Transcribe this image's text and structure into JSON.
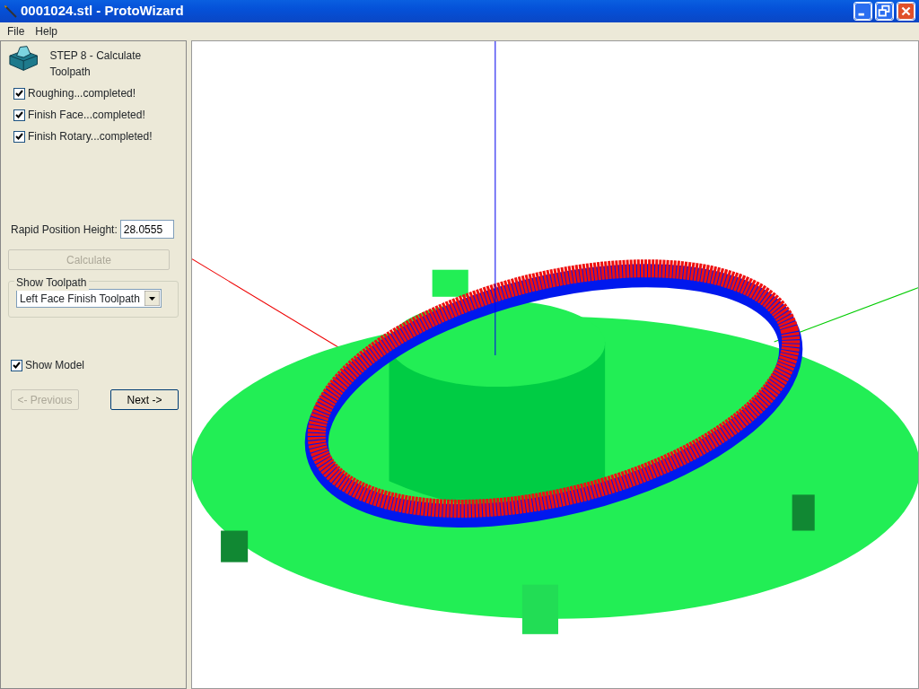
{
  "window": {
    "title": "0001024.stl - ProtoWizard"
  },
  "menu": [
    "File",
    "Help"
  ],
  "step": {
    "title": "STEP 8 - Calculate Toolpath"
  },
  "operations": [
    {
      "label": "Roughing...completed!",
      "checked": true
    },
    {
      "label": "Finish Face...completed!",
      "checked": true
    },
    {
      "label": "Finish Rotary...completed!",
      "checked": true
    }
  ],
  "rapid_height": {
    "label": "Rapid Position Height:",
    "value": "28.0555"
  },
  "calculate": {
    "label": "Calculate",
    "disabled": true
  },
  "show_toolpath": {
    "legend": "Show Toolpath",
    "value": "Left Face Finish Toolpath"
  },
  "show_model": {
    "label": "Show Model",
    "checked": true
  },
  "nav": [
    {
      "label": "<- Previous",
      "disabled": true
    },
    {
      "label": "Next ->",
      "disabled": false
    }
  ]
}
